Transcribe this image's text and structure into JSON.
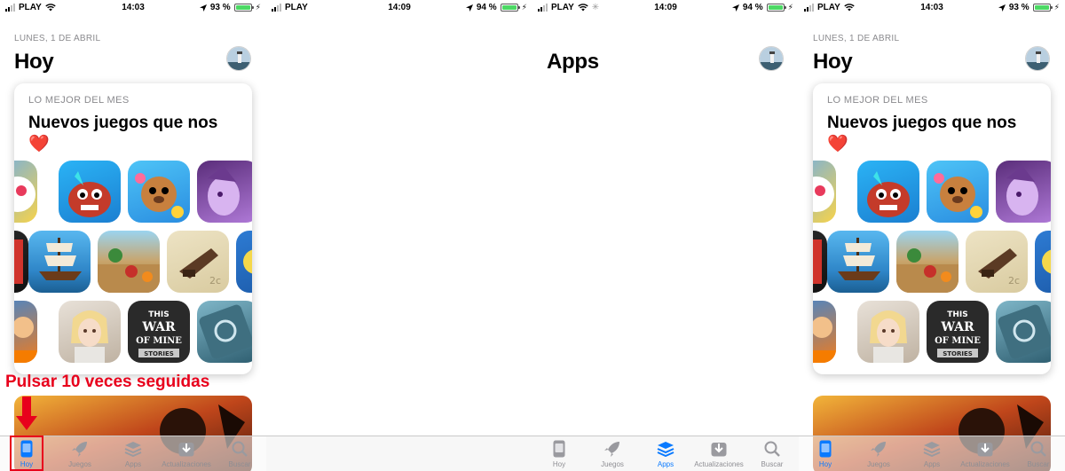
{
  "colors": {
    "accent": "#0a7aff",
    "annotation": "#e8001c",
    "heart": "#e0162b",
    "battery": "#4cd964"
  },
  "panels": [
    {
      "status": {
        "carrier": "PLAY",
        "time": "14:03",
        "battery": "93 %",
        "battery_level": 0.93
      },
      "date": "LUNES, 1 DE ABRIL",
      "title": "Hoy",
      "card": {
        "subtitle": "LO MEJOR DEL MES",
        "title": "Nuevos juegos que nos",
        "emoji": "❤️"
      },
      "annotation": "Pulsar 10 veces seguidas",
      "tabs": [
        "Hoy",
        "Juegos",
        "Apps",
        "Actualizaciones",
        "Buscar"
      ],
      "active_tab": "Hoy"
    },
    {
      "status": {
        "carrier": "PLAY",
        "time": "14:09",
        "battery": "94 %",
        "battery_level": 0.94
      }
    },
    {
      "status": {
        "carrier": "PLAY",
        "time": "14:09",
        "battery": "94 %",
        "battery_level": 0.94
      },
      "title": "Apps",
      "tabs": [
        "Hoy",
        "Juegos",
        "Apps",
        "Actualizaciones",
        "Buscar"
      ],
      "active_tab": "Apps"
    },
    {
      "status": {
        "carrier": "PLAY",
        "time": "14:03",
        "battery": "93 %",
        "battery_level": 0.93
      },
      "date": "LUNES, 1 DE ABRIL",
      "title": "Hoy",
      "card": {
        "subtitle": "LO MEJOR DEL MES",
        "title": "Nuevos juegos que nos",
        "emoji": "❤️"
      },
      "tabs": [
        "Hoy",
        "Juegos",
        "Apps",
        "Actualizaciones",
        "Buscar"
      ],
      "active_tab": "Hoy"
    }
  ]
}
